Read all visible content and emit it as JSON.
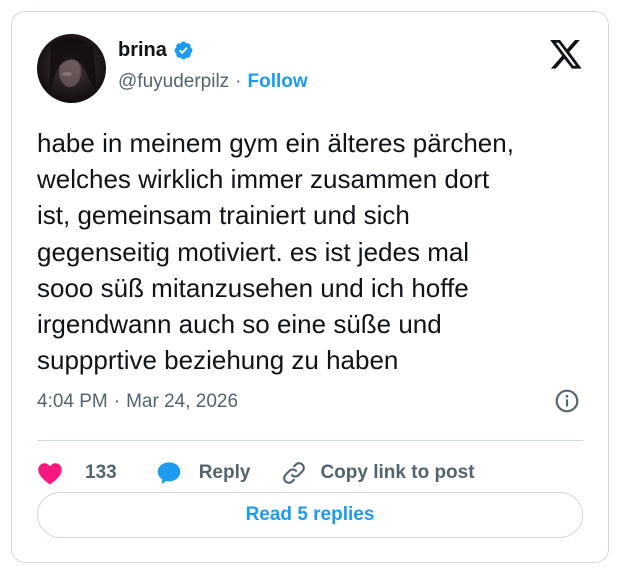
{
  "tweet": {
    "author": {
      "name": "brina",
      "handle": "@fuyuderpilz",
      "verified": true,
      "follow_label": "Follow"
    },
    "separator": "·",
    "text": "habe in meinem gym ein älteres pärchen,\nwelches wirklich immer zusammen dort\nist, gemeinsam trainiert und sich\ngegenseitig motiviert. es ist jedes mal\nsooo süß mitanzusehen und ich hoffe\nirgendwann auch so eine süße und\nsuppprtive beziehung zu haben",
    "time": "4:04 PM",
    "date": "Mar 24, 2026",
    "actions": {
      "like_count": "133",
      "reply_label": "Reply",
      "copy_link_label": "Copy link to post"
    },
    "read_replies_label": "Read 5 replies"
  },
  "colors": {
    "accent": "#1d9bf0",
    "like": "#f91880",
    "text": "#0f1419",
    "muted": "#536471",
    "border": "#cfd9de"
  },
  "icons": {
    "logo": "x-logo-icon",
    "verified": "verified-badge-icon",
    "info": "info-icon",
    "like": "heart-icon",
    "reply": "speech-bubble-icon",
    "copy": "link-icon"
  }
}
